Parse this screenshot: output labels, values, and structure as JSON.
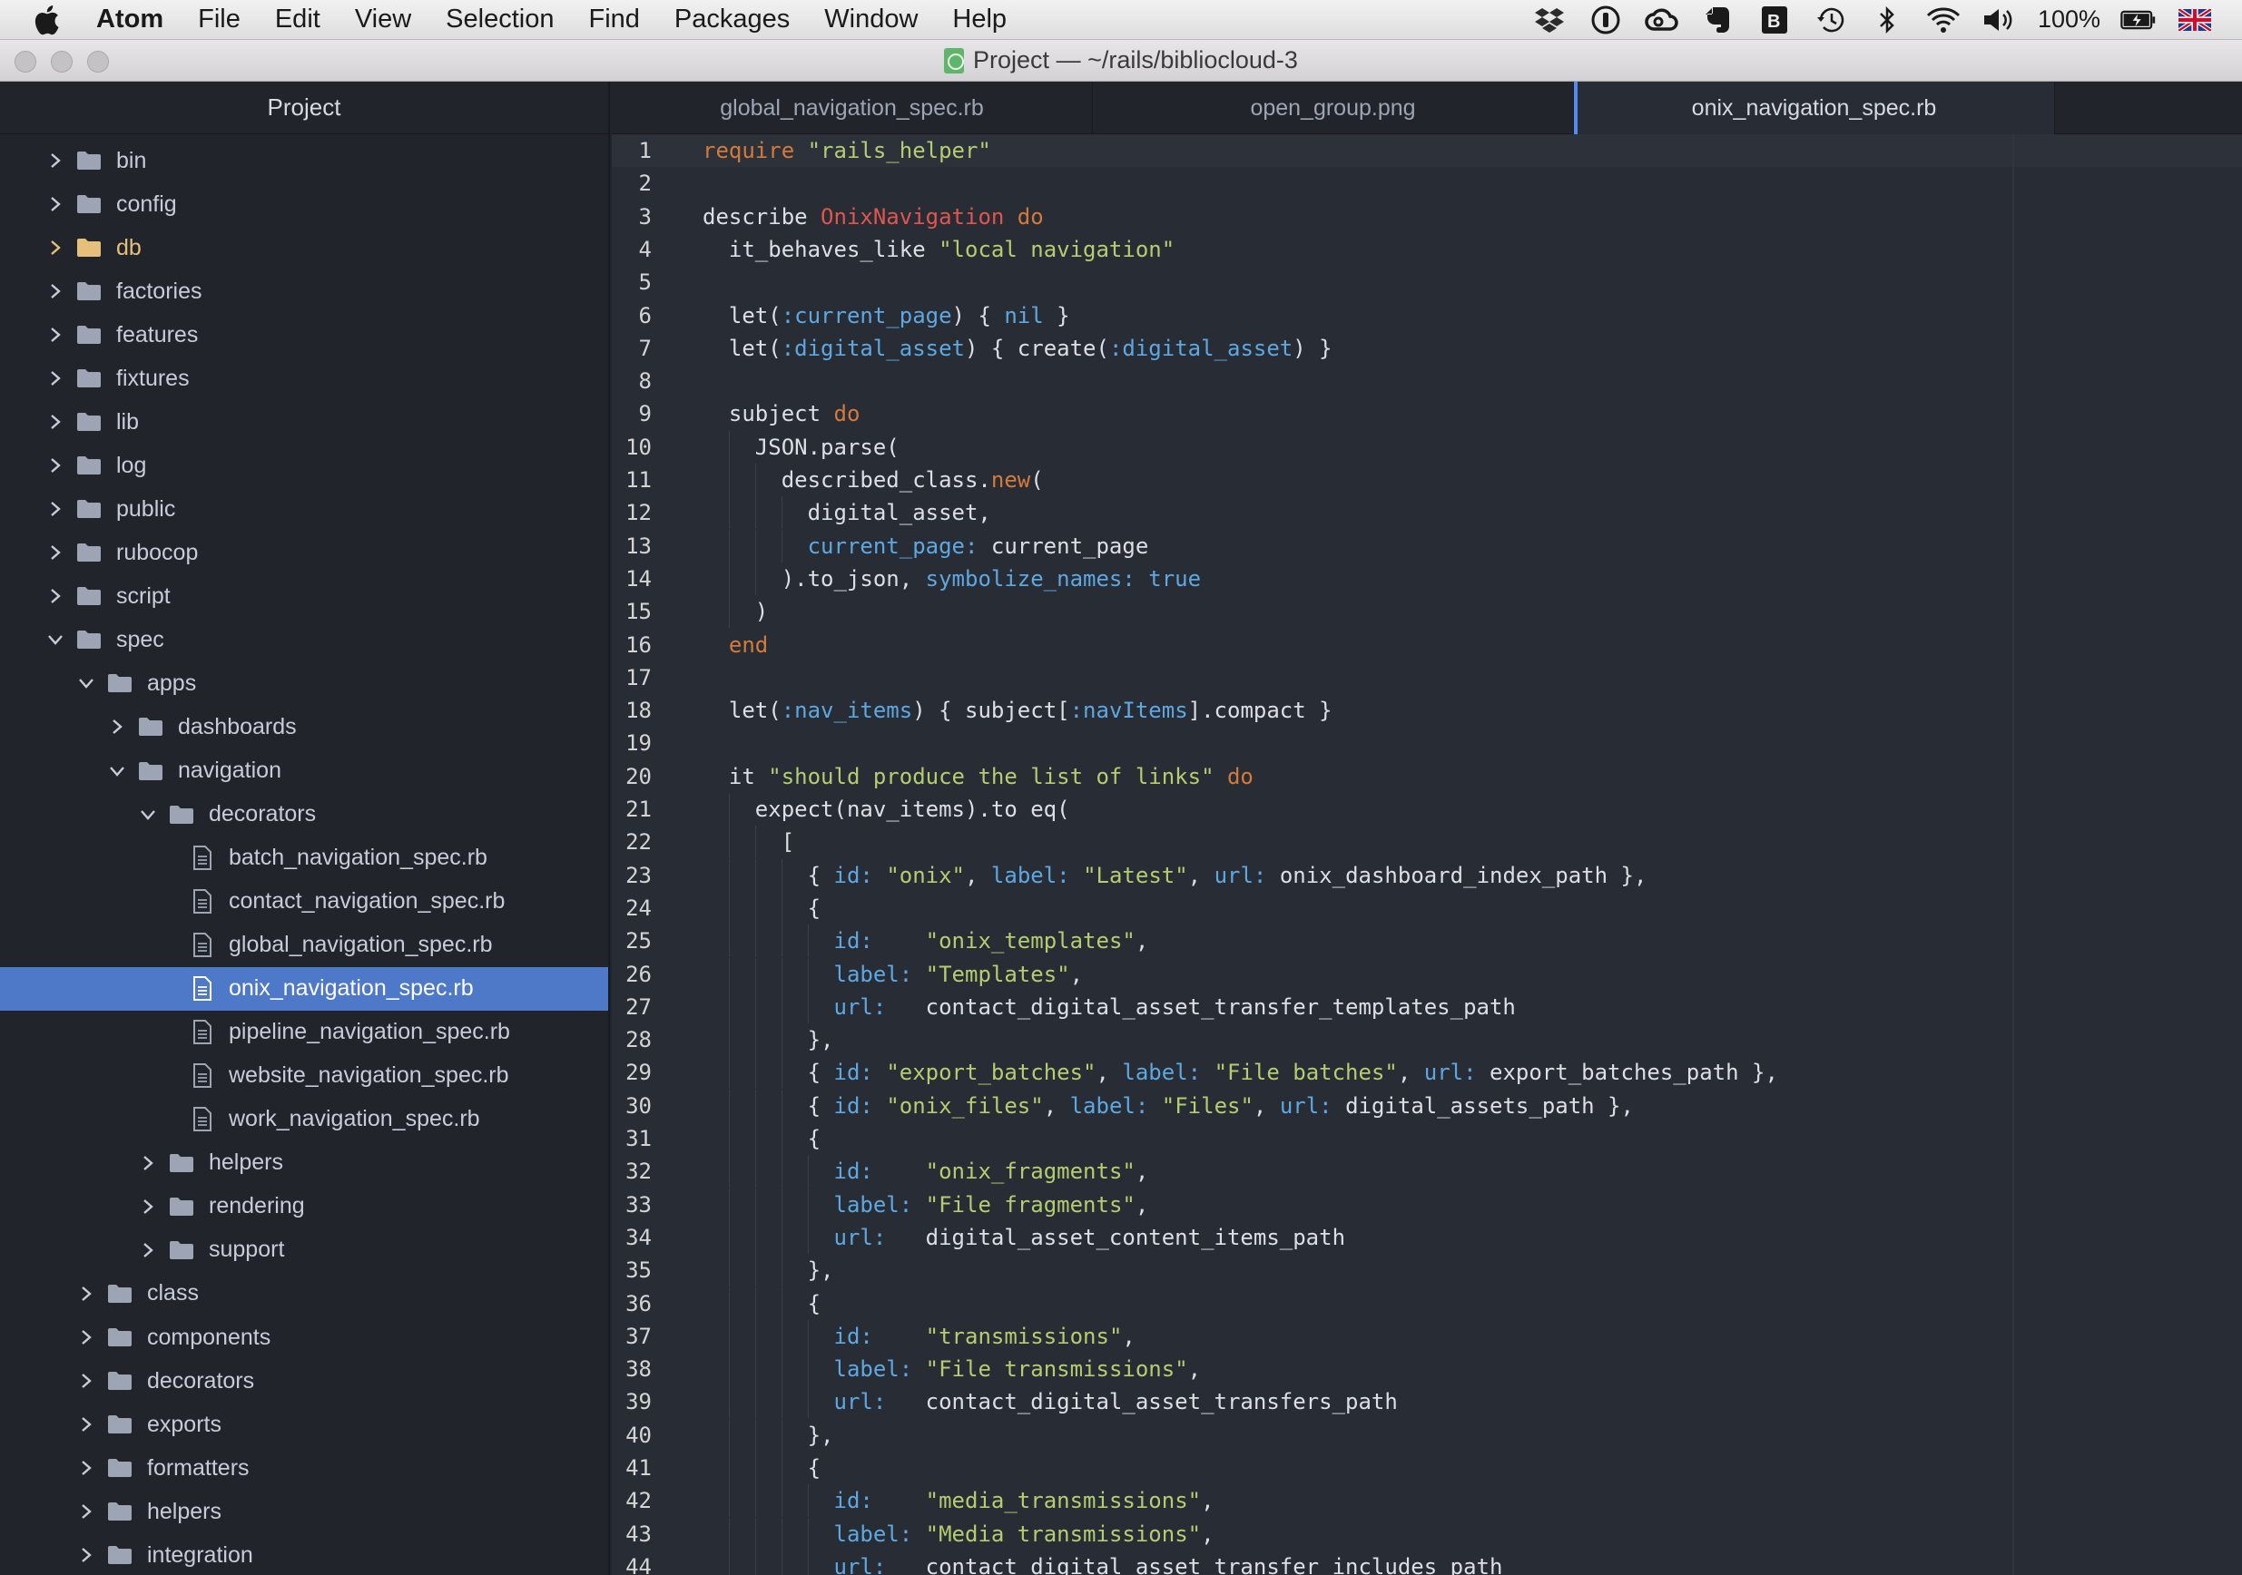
{
  "menubar": {
    "app_name": "Atom",
    "menus": [
      "File",
      "Edit",
      "View",
      "Selection",
      "Find",
      "Packages",
      "Window",
      "Help"
    ],
    "status_icons": [
      "dropbox-icon",
      "1password-icon",
      "creative-cloud-icon",
      "evernote-icon",
      "bbedit-icon",
      "time-machine-icon",
      "bluetooth-icon",
      "wifi-icon",
      "volume-icon"
    ],
    "battery_percent": "100%",
    "language_flag": "uk-flag-icon"
  },
  "window": {
    "title": "Project — ~/rails/bibliocloud-3"
  },
  "tree": {
    "header": "Project",
    "items": [
      {
        "label": "bin",
        "type": "folder",
        "depth": 0,
        "expanded": false
      },
      {
        "label": "config",
        "type": "folder",
        "depth": 0,
        "expanded": false
      },
      {
        "label": "db",
        "type": "folder",
        "depth": 0,
        "expanded": false,
        "highlight": true
      },
      {
        "label": "factories",
        "type": "folder",
        "depth": 0,
        "expanded": false
      },
      {
        "label": "features",
        "type": "folder",
        "depth": 0,
        "expanded": false
      },
      {
        "label": "fixtures",
        "type": "folder",
        "depth": 0,
        "expanded": false
      },
      {
        "label": "lib",
        "type": "folder",
        "depth": 0,
        "expanded": false
      },
      {
        "label": "log",
        "type": "folder",
        "depth": 0,
        "expanded": false
      },
      {
        "label": "public",
        "type": "folder",
        "depth": 0,
        "expanded": false
      },
      {
        "label": "rubocop",
        "type": "folder",
        "depth": 0,
        "expanded": false
      },
      {
        "label": "script",
        "type": "folder",
        "depth": 0,
        "expanded": false
      },
      {
        "label": "spec",
        "type": "folder",
        "depth": 0,
        "expanded": true
      },
      {
        "label": "apps",
        "type": "folder",
        "depth": 1,
        "expanded": true
      },
      {
        "label": "dashboards",
        "type": "folder",
        "depth": 2,
        "expanded": false
      },
      {
        "label": "navigation",
        "type": "folder",
        "depth": 2,
        "expanded": true
      },
      {
        "label": "decorators",
        "type": "folder",
        "depth": 3,
        "expanded": true
      },
      {
        "label": "batch_navigation_spec.rb",
        "type": "file",
        "depth": 4
      },
      {
        "label": "contact_navigation_spec.rb",
        "type": "file",
        "depth": 4
      },
      {
        "label": "global_navigation_spec.rb",
        "type": "file",
        "depth": 4
      },
      {
        "label": "onix_navigation_spec.rb",
        "type": "file",
        "depth": 4,
        "selected": true
      },
      {
        "label": "pipeline_navigation_spec.rb",
        "type": "file",
        "depth": 4
      },
      {
        "label": "website_navigation_spec.rb",
        "type": "file",
        "depth": 4
      },
      {
        "label": "work_navigation_spec.rb",
        "type": "file",
        "depth": 4
      },
      {
        "label": "helpers",
        "type": "folder",
        "depth": 3,
        "expanded": false
      },
      {
        "label": "rendering",
        "type": "folder",
        "depth": 3,
        "expanded": false
      },
      {
        "label": "support",
        "type": "folder",
        "depth": 3,
        "expanded": false
      },
      {
        "label": "class",
        "type": "folder",
        "depth": 1,
        "expanded": false
      },
      {
        "label": "components",
        "type": "folder",
        "depth": 1,
        "expanded": false
      },
      {
        "label": "decorators",
        "type": "folder",
        "depth": 1,
        "expanded": false
      },
      {
        "label": "exports",
        "type": "folder",
        "depth": 1,
        "expanded": false
      },
      {
        "label": "formatters",
        "type": "folder",
        "depth": 1,
        "expanded": false
      },
      {
        "label": "helpers",
        "type": "folder",
        "depth": 1,
        "expanded": false
      },
      {
        "label": "integration",
        "type": "folder",
        "depth": 1,
        "expanded": false
      }
    ]
  },
  "tabs": [
    {
      "label": "global_navigation_spec.rb",
      "active": false
    },
    {
      "label": "open_group.png",
      "active": false
    },
    {
      "label": "onix_navigation_spec.rb",
      "active": true
    }
  ],
  "syntax_colors": {
    "plain": "#dcdfe4",
    "kw": "#d37a3c",
    "str": "#b5cc70",
    "sym": "#5ea8e2",
    "const": "#e0564e"
  },
  "code": {
    "lines": [
      [
        [
          "kw",
          "require "
        ],
        [
          "str",
          "\"rails_helper\""
        ]
      ],
      [],
      [
        [
          "plain",
          "describe "
        ],
        [
          "const",
          "OnixNavigation"
        ],
        [
          "kw",
          " do"
        ]
      ],
      [
        [
          "plain",
          "  it_behaves_like "
        ],
        [
          "str",
          "\"local navigation\""
        ]
      ],
      [],
      [
        [
          "plain",
          "  let("
        ],
        [
          "sym",
          ":current_page"
        ],
        [
          "plain",
          ") { "
        ],
        [
          "sym",
          "nil"
        ],
        [
          "plain",
          " }"
        ]
      ],
      [
        [
          "plain",
          "  let("
        ],
        [
          "sym",
          ":digital_asset"
        ],
        [
          "plain",
          ") { create("
        ],
        [
          "sym",
          ":digital_asset"
        ],
        [
          "plain",
          ") }"
        ]
      ],
      [],
      [
        [
          "plain",
          "  subject "
        ],
        [
          "kw",
          "do"
        ]
      ],
      [
        [
          "plain",
          "    JSON.parse("
        ]
      ],
      [
        [
          "plain",
          "      described_class."
        ],
        [
          "kw",
          "new"
        ],
        [
          "plain",
          "("
        ]
      ],
      [
        [
          "plain",
          "        digital_asset,"
        ]
      ],
      [
        [
          "plain",
          "        "
        ],
        [
          "sym",
          "current_page:"
        ],
        [
          "plain",
          " current_page"
        ]
      ],
      [
        [
          "plain",
          "      ).to_json, "
        ],
        [
          "sym",
          "symbolize_names:"
        ],
        [
          "plain",
          " "
        ],
        [
          "sym",
          "true"
        ]
      ],
      [
        [
          "plain",
          "    )"
        ]
      ],
      [
        [
          "kw",
          "  end"
        ]
      ],
      [],
      [
        [
          "plain",
          "  let("
        ],
        [
          "sym",
          ":nav_items"
        ],
        [
          "plain",
          ") { subject["
        ],
        [
          "sym",
          ":navItems"
        ],
        [
          "plain",
          "].compact }"
        ]
      ],
      [],
      [
        [
          "plain",
          "  it "
        ],
        [
          "str",
          "\"should produce the list of links\""
        ],
        [
          "kw",
          " do"
        ]
      ],
      [
        [
          "plain",
          "    expect(nav_items).to eq("
        ]
      ],
      [
        [
          "plain",
          "      ["
        ]
      ],
      [
        [
          "plain",
          "        { "
        ],
        [
          "sym",
          "id:"
        ],
        [
          "plain",
          " "
        ],
        [
          "str",
          "\"onix\""
        ],
        [
          "plain",
          ", "
        ],
        [
          "sym",
          "label:"
        ],
        [
          "plain",
          " "
        ],
        [
          "str",
          "\"Latest\""
        ],
        [
          "plain",
          ", "
        ],
        [
          "sym",
          "url:"
        ],
        [
          "plain",
          " onix_dashboard_index_path },"
        ]
      ],
      [
        [
          "plain",
          "        {"
        ]
      ],
      [
        [
          "plain",
          "          "
        ],
        [
          "sym",
          "id:"
        ],
        [
          "plain",
          "    "
        ],
        [
          "str",
          "\"onix_templates\""
        ],
        [
          "plain",
          ","
        ]
      ],
      [
        [
          "plain",
          "          "
        ],
        [
          "sym",
          "label:"
        ],
        [
          "plain",
          " "
        ],
        [
          "str",
          "\"Templates\""
        ],
        [
          "plain",
          ","
        ]
      ],
      [
        [
          "plain",
          "          "
        ],
        [
          "sym",
          "url:"
        ],
        [
          "plain",
          "   contact_digital_asset_transfer_templates_path"
        ]
      ],
      [
        [
          "plain",
          "        },"
        ]
      ],
      [
        [
          "plain",
          "        { "
        ],
        [
          "sym",
          "id:"
        ],
        [
          "plain",
          " "
        ],
        [
          "str",
          "\"export_batches\""
        ],
        [
          "plain",
          ", "
        ],
        [
          "sym",
          "label:"
        ],
        [
          "plain",
          " "
        ],
        [
          "str",
          "\"File batches\""
        ],
        [
          "plain",
          ", "
        ],
        [
          "sym",
          "url:"
        ],
        [
          "plain",
          " export_batches_path },"
        ]
      ],
      [
        [
          "plain",
          "        { "
        ],
        [
          "sym",
          "id:"
        ],
        [
          "plain",
          " "
        ],
        [
          "str",
          "\"onix_files\""
        ],
        [
          "plain",
          ", "
        ],
        [
          "sym",
          "label:"
        ],
        [
          "plain",
          " "
        ],
        [
          "str",
          "\"Files\""
        ],
        [
          "plain",
          ", "
        ],
        [
          "sym",
          "url:"
        ],
        [
          "plain",
          " digital_assets_path },"
        ]
      ],
      [
        [
          "plain",
          "        {"
        ]
      ],
      [
        [
          "plain",
          "          "
        ],
        [
          "sym",
          "id:"
        ],
        [
          "plain",
          "    "
        ],
        [
          "str",
          "\"onix_fragments\""
        ],
        [
          "plain",
          ","
        ]
      ],
      [
        [
          "plain",
          "          "
        ],
        [
          "sym",
          "label:"
        ],
        [
          "plain",
          " "
        ],
        [
          "str",
          "\"File fragments\""
        ],
        [
          "plain",
          ","
        ]
      ],
      [
        [
          "plain",
          "          "
        ],
        [
          "sym",
          "url:"
        ],
        [
          "plain",
          "   digital_asset_content_items_path"
        ]
      ],
      [
        [
          "plain",
          "        },"
        ]
      ],
      [
        [
          "plain",
          "        {"
        ]
      ],
      [
        [
          "plain",
          "          "
        ],
        [
          "sym",
          "id:"
        ],
        [
          "plain",
          "    "
        ],
        [
          "str",
          "\"transmissions\""
        ],
        [
          "plain",
          ","
        ]
      ],
      [
        [
          "plain",
          "          "
        ],
        [
          "sym",
          "label:"
        ],
        [
          "plain",
          " "
        ],
        [
          "str",
          "\"File transmissions\""
        ],
        [
          "plain",
          ","
        ]
      ],
      [
        [
          "plain",
          "          "
        ],
        [
          "sym",
          "url:"
        ],
        [
          "plain",
          "   contact_digital_asset_transfers_path"
        ]
      ],
      [
        [
          "plain",
          "        },"
        ]
      ],
      [
        [
          "plain",
          "        {"
        ]
      ],
      [
        [
          "plain",
          "          "
        ],
        [
          "sym",
          "id:"
        ],
        [
          "plain",
          "    "
        ],
        [
          "str",
          "\"media_transmissions\""
        ],
        [
          "plain",
          ","
        ]
      ],
      [
        [
          "plain",
          "          "
        ],
        [
          "sym",
          "label:"
        ],
        [
          "plain",
          " "
        ],
        [
          "str",
          "\"Media transmissions\""
        ],
        [
          "plain",
          ","
        ]
      ],
      [
        [
          "plain",
          "          "
        ],
        [
          "sym",
          "url:"
        ],
        [
          "plain",
          "   contact_digital_asset_transfer_includes_path"
        ]
      ]
    ]
  }
}
